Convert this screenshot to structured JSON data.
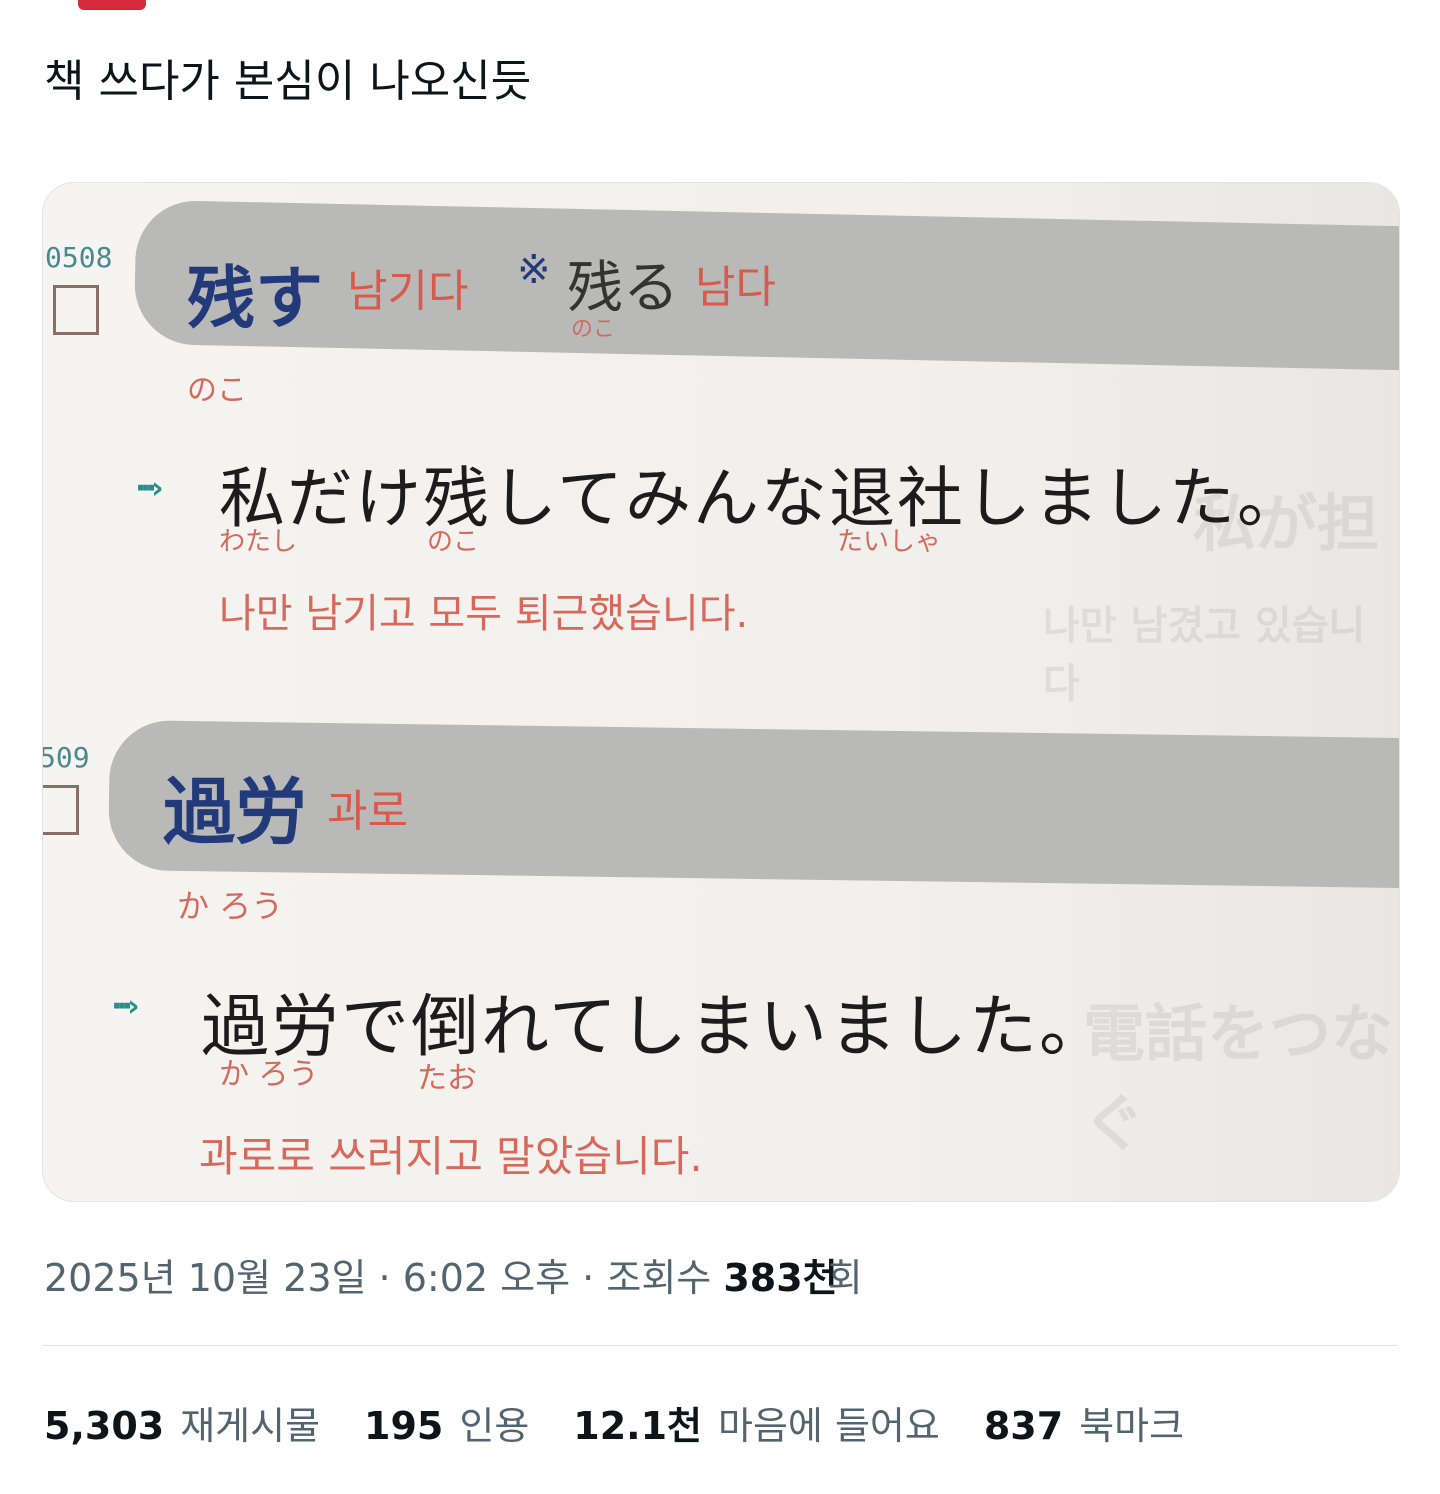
{
  "tweet": {
    "text": "책 쓰다가 본심이 나오신듯"
  },
  "media": {
    "entries": [
      {
        "number": "0508",
        "word": "残す",
        "meaning": "남기다",
        "ref_mark": "※",
        "ref_word": "残る",
        "ref_meaning": "남다",
        "ref_ruby": "のこ",
        "word_ruby": "のこ",
        "sentence": "私だけ残してみんな退社しました。",
        "sentence_ruby": [
          "わたし",
          "のこ",
          "たいしゃ"
        ],
        "translation": "나만 남기고 모두 퇴근했습니다."
      },
      {
        "number": "509",
        "word": "過労",
        "meaning": "과로",
        "word_ruby": "か ろう",
        "sentence": "過労で倒れてしまいました。",
        "sentence_ruby": [
          "か ろう",
          "たお"
        ],
        "translation": "과로로 쓰러지고 말았습니다."
      }
    ],
    "arrow": "···›"
  },
  "meta": {
    "date": "2025년 10월 23일",
    "time": "6:02 오후",
    "views_label": "조회수",
    "views_value": "383천",
    "views_suffix": "회",
    "separator": "·"
  },
  "stats": {
    "reposts": {
      "value": "5,303",
      "label": "재게시물"
    },
    "quotes": {
      "value": "195",
      "label": "인용"
    },
    "likes": {
      "value": "12.1천",
      "label": "마음에 들어요"
    },
    "bookmarks": {
      "value": "837",
      "label": "북마크"
    }
  }
}
